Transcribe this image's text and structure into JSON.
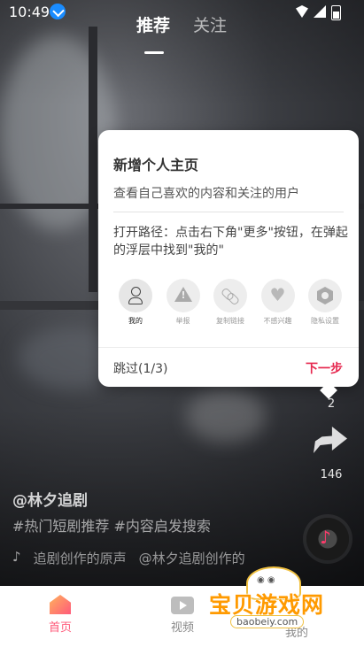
{
  "status_bar": {
    "time": "10:49"
  },
  "top_tabs": {
    "recommend": "推荐",
    "follow": "关注"
  },
  "side_actions": {
    "comment_count": "2",
    "share_count": "146"
  },
  "video_info": {
    "author": "@林夕追剧",
    "tags": "#热门短剧推荐 #内容启发搜索",
    "music_left": "追剧创作的原声",
    "music_right": "@林夕追剧创作的"
  },
  "popup": {
    "title": "新增个人主页",
    "description": "查看自己喜欢的内容和关注的用户",
    "path": "打开路径：点击右下角\"更多\"按钮，在弹起的浮层中找到\"我的\"",
    "items": [
      {
        "label": "我的",
        "icon": "person-icon"
      },
      {
        "label": "举报",
        "icon": "warning-icon"
      },
      {
        "label": "复制链接",
        "icon": "link-icon"
      },
      {
        "label": "不感兴趣",
        "icon": "broken-heart-icon"
      },
      {
        "label": "隐私设置",
        "icon": "privacy-icon"
      }
    ],
    "skip_label": "跳过(1/3)",
    "next_label": "下一步"
  },
  "bottom_nav": {
    "home": "首页",
    "video": "视频",
    "third": "我的"
  },
  "watermark": {
    "text": "宝贝游戏网",
    "url": "baobeiy.com"
  },
  "colors": {
    "accent": "#e6284f",
    "home_active": "#ff5a7a",
    "watermark": "#ff9a00"
  }
}
